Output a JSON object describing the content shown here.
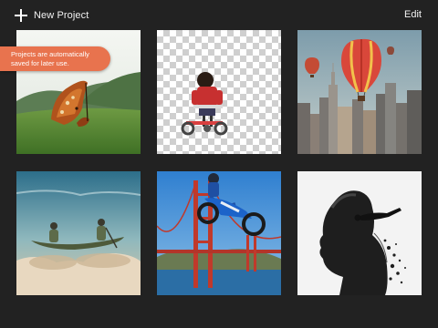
{
  "header": {
    "new_project_label": "New Project",
    "edit_label": "Edit"
  },
  "tooltip": {
    "line1": "Projects are automatically",
    "line2": "saved for later use."
  },
  "colors": {
    "background": "#222222",
    "tooltip": "#e8734e",
    "text": "#ffffff"
  },
  "icons": {
    "new_project": "plus-icon"
  },
  "projects": [
    {
      "subject": "butterfly-wings-over-green-field"
    },
    {
      "subject": "child-on-tricycle-transparent-background"
    },
    {
      "subject": "hot-air-balloons-over-city-skyline"
    },
    {
      "subject": "canoe-floating-on-clouds"
    },
    {
      "subject": "motocross-jump-over-golden-gate-bridge"
    },
    {
      "subject": "double-exposure-portrait-with-skydiver"
    }
  ]
}
